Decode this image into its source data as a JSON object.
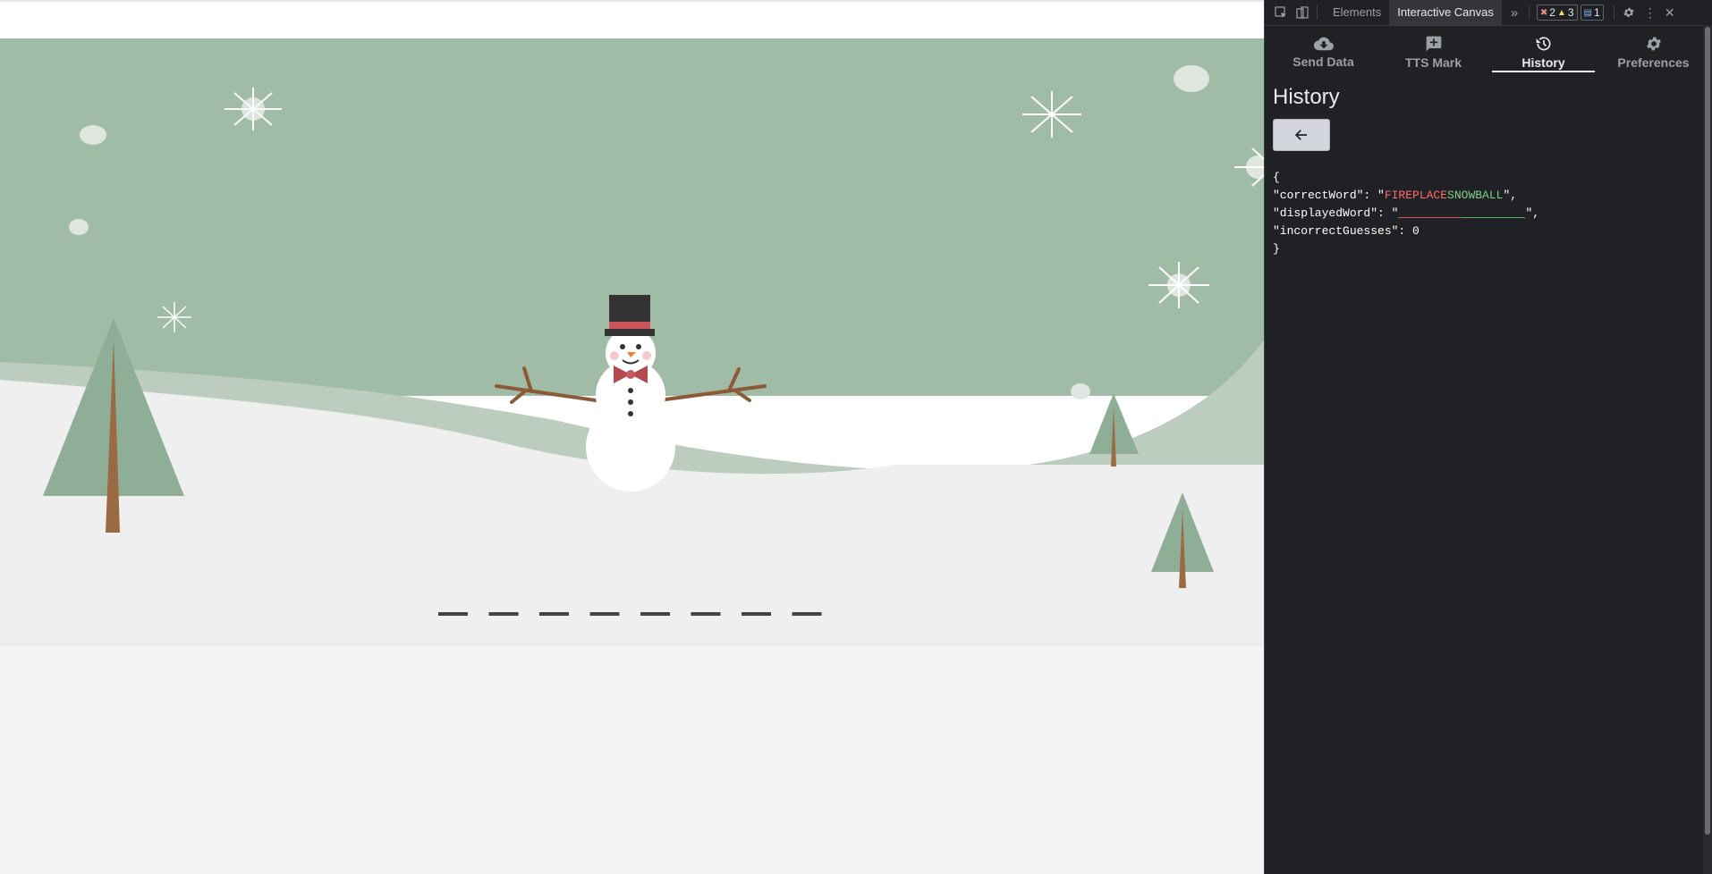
{
  "colors": {
    "sky": "#a1bca6",
    "hill": "#bccdbf",
    "snow": "#efefef",
    "ground": "#f4f4f4",
    "tree": "#8fae97",
    "trunk": "#9a6a43",
    "hat": "#333333",
    "hat_band": "#c9545a",
    "bowtie": "#b34a4f",
    "nose": "#e9843b",
    "dash": "#444444",
    "devtools_bg": "#202124"
  },
  "game": {
    "word_blanks": 8
  },
  "devtools": {
    "tabs": [
      {
        "label": "Elements",
        "active": false
      },
      {
        "label": "Interactive Canvas",
        "active": true
      }
    ],
    "badges": {
      "errors": "2",
      "warnings": "3",
      "messages": "1"
    },
    "ext_tabs": [
      {
        "label": "Send Data",
        "icon": "cloud-download-icon",
        "active": false
      },
      {
        "label": "TTS Mark",
        "icon": "add-comment-icon",
        "active": false
      },
      {
        "label": "History",
        "icon": "history-icon",
        "active": true
      },
      {
        "label": "Preferences",
        "icon": "gear-icon",
        "active": false
      }
    ],
    "panel_title": "History",
    "json": {
      "open": "{",
      "close": "}",
      "correct_key": "\"correctWord\": \"",
      "correct_part1": "FIREPLACE",
      "correct_part2": "SNOWBALL",
      "correct_end": "\",",
      "displayed_key": "\"displayedWord\": \"",
      "displayed_end": "\",",
      "incorrect_line": "\"incorrectGuesses\": 0"
    }
  }
}
